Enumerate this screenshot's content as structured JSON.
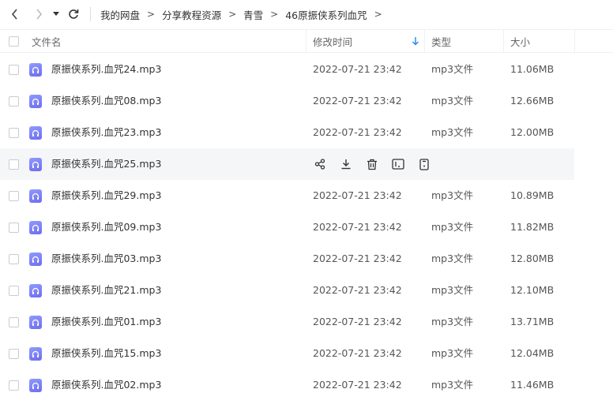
{
  "nav": {
    "back_icon": "chevron-left-icon",
    "forward_icon": "chevron-right-icon",
    "dropdown_icon": "caret-down-icon",
    "refresh_icon": "refresh-icon"
  },
  "breadcrumb": [
    "我的网盘",
    "分享教程资源",
    "青雪",
    "46原振侠系列血咒"
  ],
  "breadcrumb_separator": ">",
  "columns": {
    "name": "文件名",
    "modified": "修改时间",
    "type": "类型",
    "size": "大小"
  },
  "sort": {
    "column": "modified",
    "icon": "arrow-down-icon",
    "color": "#2d8cf0"
  },
  "file_icon": {
    "name": "audio-file-icon",
    "color": "#7b7ff5"
  },
  "hover_actions": [
    "share-icon",
    "download-icon",
    "delete-icon",
    "rename-icon",
    "more-icon"
  ],
  "files": [
    {
      "name": "原振侠系列.血咒24.mp3",
      "modified": "2022-07-21 23:42",
      "type": "mp3文件",
      "size": "11.06MB"
    },
    {
      "name": "原振侠系列.血咒08.mp3",
      "modified": "2022-07-21 23:42",
      "type": "mp3文件",
      "size": "12.66MB"
    },
    {
      "name": "原振侠系列.血咒23.mp3",
      "modified": "2022-07-21 23:42",
      "type": "mp3文件",
      "size": "12.00MB"
    },
    {
      "name": "原振侠系列.血咒25.mp3",
      "hovered": true
    },
    {
      "name": "原振侠系列.血咒29.mp3",
      "modified": "2022-07-21 23:42",
      "type": "mp3文件",
      "size": "10.89MB"
    },
    {
      "name": "原振侠系列.血咒09.mp3",
      "modified": "2022-07-21 23:42",
      "type": "mp3文件",
      "size": "11.82MB"
    },
    {
      "name": "原振侠系列.血咒03.mp3",
      "modified": "2022-07-21 23:42",
      "type": "mp3文件",
      "size": "12.80MB"
    },
    {
      "name": "原振侠系列.血咒21.mp3",
      "modified": "2022-07-21 23:42",
      "type": "mp3文件",
      "size": "12.10MB"
    },
    {
      "name": "原振侠系列.血咒01.mp3",
      "modified": "2022-07-21 23:42",
      "type": "mp3文件",
      "size": "13.71MB"
    },
    {
      "name": "原振侠系列.血咒15.mp3",
      "modified": "2022-07-21 23:42",
      "type": "mp3文件",
      "size": "12.04MB"
    },
    {
      "name": "原振侠系列.血咒02.mp3",
      "modified": "2022-07-21 23:42",
      "type": "mp3文件",
      "size": "11.46MB"
    }
  ]
}
